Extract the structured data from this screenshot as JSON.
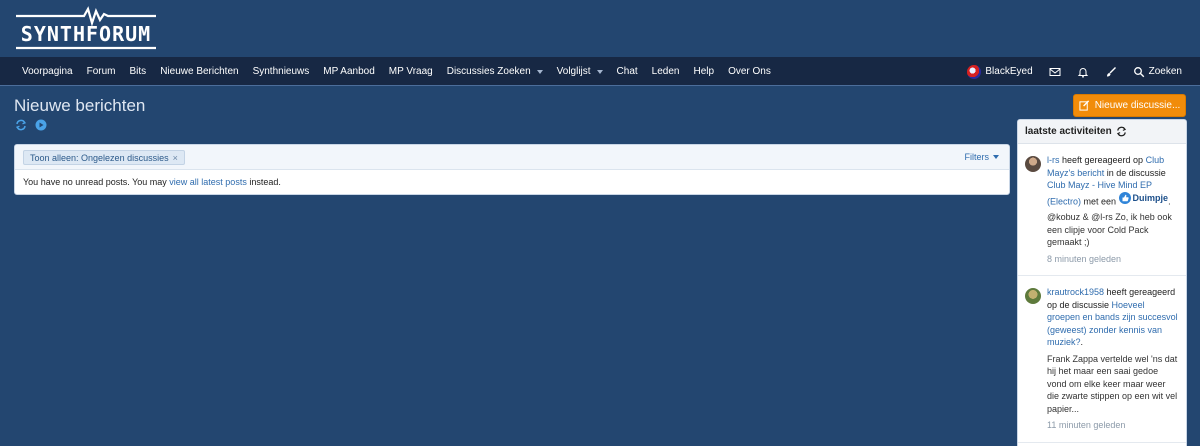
{
  "brand": {
    "name": "SYNTHFORUM"
  },
  "nav": {
    "items": [
      {
        "label": "Voorpagina"
      },
      {
        "label": "Forum"
      },
      {
        "label": "Bits"
      },
      {
        "label": "Nieuwe Berichten"
      },
      {
        "label": "Synthnieuws"
      },
      {
        "label": "MP Aanbod"
      },
      {
        "label": "MP Vraag"
      },
      {
        "label": "Discussies Zoeken",
        "dropdown": true
      },
      {
        "label": "Volglijst",
        "dropdown": true
      },
      {
        "label": "Chat"
      },
      {
        "label": "Leden"
      },
      {
        "label": "Help"
      },
      {
        "label": "Over Ons"
      }
    ],
    "user": {
      "name": "BlackEyed"
    },
    "search_label": "Zoeken"
  },
  "page": {
    "title": "Nieuwe berichten",
    "new_thread_label": "Nieuwe discussie..."
  },
  "filter": {
    "tag_label": "Toon alleen: Ongelezen discussies",
    "tag_close": "×",
    "filters_label": "Filters"
  },
  "message": {
    "prefix": "You have no unread posts. You may ",
    "link": "view all latest posts",
    "suffix": " instead."
  },
  "sidebar": {
    "title": "laatste activiteiten",
    "activities": [
      {
        "user": "l-rs",
        "text1": " heeft gereageerd op ",
        "link1": "Club Mayz's bericht",
        "text2": " in de discussie ",
        "link2": "Club Mayz - Hive Mind EP (Electro)",
        "text3": " met een ",
        "reaction": "Duimpje",
        "text4": ".",
        "snippet": "@kobuz & @l-rs Zo, ik heb ook een clipje voor Cold Pack gemaakt ;)",
        "time": "8 minuten geleden"
      },
      {
        "user": "krautrock1958",
        "text1": " heeft gereageerd op de discussie ",
        "link1": "Hoeveel groepen en bands zijn succesvol (geweest) zonder kennis van muziek?",
        "text2": ".",
        "snippet": "Frank Zappa vertelde wel 'ns dat hij het maar een saai gedoe vond om elke keer maar weer die zwarte stippen op een wit vel papier...",
        "time": "11 minuten geleden"
      }
    ]
  },
  "colors": {
    "background": "#234670",
    "navbar": "#172844",
    "accent": "#f18c0a",
    "link": "#2f6cae"
  }
}
